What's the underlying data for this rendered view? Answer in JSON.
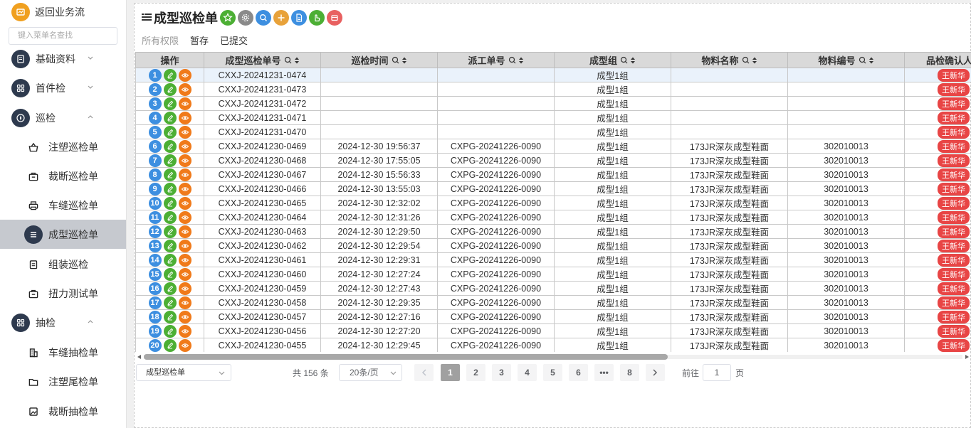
{
  "sidebar": {
    "back_label": "返回业务流",
    "search_placeholder": "键入菜单名查找",
    "items": [
      {
        "label": "基础资料",
        "icon": "document-icon",
        "level": "top",
        "chevron": "down"
      },
      {
        "label": "首件检",
        "icon": "grid-icon",
        "level": "top",
        "chevron": "down"
      },
      {
        "label": "巡检",
        "icon": "compass-icon",
        "level": "top",
        "chevron": "up"
      },
      {
        "label": "注塑巡检单",
        "icon": "basket-icon",
        "level": "sub"
      },
      {
        "label": "裁断巡检单",
        "icon": "briefcase-icon",
        "level": "sub"
      },
      {
        "label": "车缝巡检单",
        "icon": "printer-icon",
        "level": "sub"
      },
      {
        "label": "成型巡检单",
        "icon": "list-icon",
        "level": "sub",
        "active": true
      },
      {
        "label": "组装巡检",
        "icon": "clipboard-icon",
        "level": "sub"
      },
      {
        "label": "扭力测试单",
        "icon": "briefcase-icon",
        "level": "sub"
      },
      {
        "label": "抽检",
        "icon": "grid-icon",
        "level": "top",
        "chevron": "up"
      },
      {
        "label": "车缝抽检单",
        "icon": "building-icon",
        "level": "sub"
      },
      {
        "label": "注塑尾检单",
        "icon": "folder-icon",
        "level": "sub"
      },
      {
        "label": "裁断抽检单",
        "icon": "image-icon",
        "level": "sub"
      }
    ]
  },
  "header": {
    "title": "成型巡检单",
    "toolbar": [
      {
        "name": "star-button",
        "color": "#4caf34"
      },
      {
        "name": "settings-button",
        "color": "#8a8a8a"
      },
      {
        "name": "search-button",
        "color": "#3d8fe0"
      },
      {
        "name": "add-button",
        "color": "#e8a23a"
      },
      {
        "name": "export-button",
        "color": "#3d8fe0"
      },
      {
        "name": "hand-button",
        "color": "#4caf34"
      },
      {
        "name": "delete-button",
        "color": "#e86060"
      }
    ],
    "tabs": [
      "所有权限",
      "暂存",
      "已提交"
    ]
  },
  "table": {
    "columns": [
      "操作",
      "成型巡检单号",
      "巡检时间",
      "派工单号",
      "成型组",
      "物料名称",
      "物料编号",
      "品检确认人"
    ],
    "confirm_label": "王新华",
    "rows": [
      {
        "n": "1",
        "code": "CXXJ-20241231-0474",
        "time": "",
        "dispatch": "",
        "group": "成型1组",
        "material": "",
        "matno": ""
      },
      {
        "n": "2",
        "code": "CXXJ-20241231-0473",
        "time": "",
        "dispatch": "",
        "group": "成型1组",
        "material": "",
        "matno": ""
      },
      {
        "n": "3",
        "code": "CXXJ-20241231-0472",
        "time": "",
        "dispatch": "",
        "group": "成型1组",
        "material": "",
        "matno": ""
      },
      {
        "n": "4",
        "code": "CXXJ-20241231-0471",
        "time": "",
        "dispatch": "",
        "group": "成型1组",
        "material": "",
        "matno": ""
      },
      {
        "n": "5",
        "code": "CXXJ-20241231-0470",
        "time": "",
        "dispatch": "",
        "group": "成型1组",
        "material": "",
        "matno": ""
      },
      {
        "n": "6",
        "code": "CXXJ-20241230-0469",
        "time": "2024-12-30 19:56:37",
        "dispatch": "CXPG-20241226-0090",
        "group": "成型1组",
        "material": "173JR深灰成型鞋面",
        "matno": "302010013"
      },
      {
        "n": "7",
        "code": "CXXJ-20241230-0468",
        "time": "2024-12-30 17:55:05",
        "dispatch": "CXPG-20241226-0090",
        "group": "成型1组",
        "material": "173JR深灰成型鞋面",
        "matno": "302010013"
      },
      {
        "n": "8",
        "code": "CXXJ-20241230-0467",
        "time": "2024-12-30 15:56:33",
        "dispatch": "CXPG-20241226-0090",
        "group": "成型1组",
        "material": "173JR深灰成型鞋面",
        "matno": "302010013"
      },
      {
        "n": "9",
        "code": "CXXJ-20241230-0466",
        "time": "2024-12-30 13:55:03",
        "dispatch": "CXPG-20241226-0090",
        "group": "成型1组",
        "material": "173JR深灰成型鞋面",
        "matno": "302010013"
      },
      {
        "n": "10",
        "code": "CXXJ-20241230-0465",
        "time": "2024-12-30 12:32:02",
        "dispatch": "CXPG-20241226-0090",
        "group": "成型1组",
        "material": "173JR深灰成型鞋面",
        "matno": "302010013"
      },
      {
        "n": "11",
        "code": "CXXJ-20241230-0464",
        "time": "2024-12-30 12:31:26",
        "dispatch": "CXPG-20241226-0090",
        "group": "成型1组",
        "material": "173JR深灰成型鞋面",
        "matno": "302010013"
      },
      {
        "n": "12",
        "code": "CXXJ-20241230-0463",
        "time": "2024-12-30 12:29:50",
        "dispatch": "CXPG-20241226-0090",
        "group": "成型1组",
        "material": "173JR深灰成型鞋面",
        "matno": "302010013"
      },
      {
        "n": "13",
        "code": "CXXJ-20241230-0462",
        "time": "2024-12-30 12:29:54",
        "dispatch": "CXPG-20241226-0090",
        "group": "成型1组",
        "material": "173JR深灰成型鞋面",
        "matno": "302010013"
      },
      {
        "n": "14",
        "code": "CXXJ-20241230-0461",
        "time": "2024-12-30 12:29:31",
        "dispatch": "CXPG-20241226-0090",
        "group": "成型1组",
        "material": "173JR深灰成型鞋面",
        "matno": "302010013"
      },
      {
        "n": "15",
        "code": "CXXJ-20241230-0460",
        "time": "2024-12-30 12:27:24",
        "dispatch": "CXPG-20241226-0090",
        "group": "成型1组",
        "material": "173JR深灰成型鞋面",
        "matno": "302010013"
      },
      {
        "n": "16",
        "code": "CXXJ-20241230-0459",
        "time": "2024-12-30 12:27:43",
        "dispatch": "CXPG-20241226-0090",
        "group": "成型1组",
        "material": "173JR深灰成型鞋面",
        "matno": "302010013"
      },
      {
        "n": "17",
        "code": "CXXJ-20241230-0458",
        "time": "2024-12-30 12:29:35",
        "dispatch": "CXPG-20241226-0090",
        "group": "成型1组",
        "material": "173JR深灰成型鞋面",
        "matno": "302010013"
      },
      {
        "n": "18",
        "code": "CXXJ-20241230-0457",
        "time": "2024-12-30 12:27:16",
        "dispatch": "CXPG-20241226-0090",
        "group": "成型1组",
        "material": "173JR深灰成型鞋面",
        "matno": "302010013"
      },
      {
        "n": "19",
        "code": "CXXJ-20241230-0456",
        "time": "2024-12-30 12:27:20",
        "dispatch": "CXPG-20241226-0090",
        "group": "成型1组",
        "material": "173JR深灰成型鞋面",
        "matno": "302010013"
      },
      {
        "n": "20",
        "code": "CXXJ-20241230-0455",
        "time": "2024-12-30 12:29:45",
        "dispatch": "CXPG-20241226-0090",
        "group": "成型1组",
        "material": "173JR深灰成型鞋面",
        "matno": "302010013"
      }
    ]
  },
  "pager": {
    "form_select": "成型巡检单",
    "total": "共 156 条",
    "page_size": "20条/页",
    "pages": [
      "1",
      "2",
      "3",
      "4",
      "5",
      "6",
      "•••",
      "8"
    ],
    "current": "1",
    "goto_label": "前往",
    "goto_value": "1",
    "goto_unit": "页"
  },
  "colors": {
    "accent": "#3d8fe0",
    "sidebar_active": "#c6c9cf",
    "sidebar_icon": "#2e3a4e",
    "confirm": "#e84545",
    "edit": "#4caf34",
    "view": "#f07a1a"
  }
}
